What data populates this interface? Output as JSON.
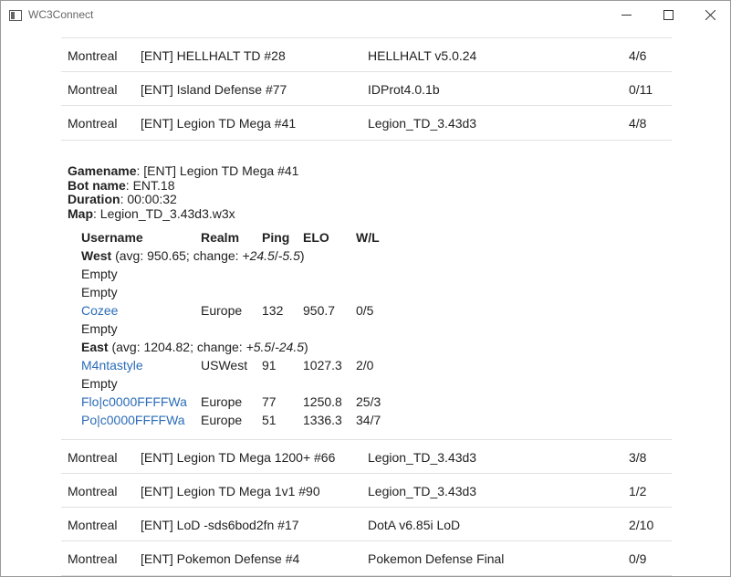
{
  "window": {
    "title": "WC3Connect",
    "icons": {
      "app": "window-app-icon",
      "minimize": "minimize-icon",
      "maximize": "maximize-icon",
      "close": "close-icon"
    }
  },
  "games_top": [
    {
      "location": "Montreal",
      "name": "[ENT] HELLHALT TD #28",
      "map": "HELLHALT v5.0.24",
      "slots": "4/6"
    },
    {
      "location": "Montreal",
      "name": "[ENT] Island Defense #77",
      "map": "IDProt4.0.1b",
      "slots": "0/11"
    },
    {
      "location": "Montreal",
      "name": "[ENT] Legion TD Mega #41",
      "map": "Legion_TD_3.43d3",
      "slots": "4/8"
    }
  ],
  "details": {
    "gamename_label": "Gamename",
    "gamename": "[ENT] Legion TD Mega #41",
    "botname_label": "Bot name",
    "botname": "ENT.18",
    "duration_label": "Duration",
    "duration": "00:00:32",
    "map_label": "Map",
    "map": "Legion_TD_3.43d3.w3x"
  },
  "players": {
    "headers": {
      "username": "Username",
      "realm": "Realm",
      "ping": "Ping",
      "elo": "ELO",
      "wl": "W/L"
    },
    "west": {
      "label": "West",
      "pre": " (avg: 950.65; change: ",
      "plus": "+24.5",
      "sep": "/",
      "minus": "-5.5",
      "post": ")"
    },
    "east": {
      "label": "East",
      "pre": " (avg: 1204.82; change: ",
      "plus": "+5.5",
      "sep": "/",
      "minus": "-24.5",
      "post": ")"
    },
    "west_rows": [
      {
        "username": "Empty",
        "realm": "",
        "ping": "",
        "elo": "",
        "wl": ""
      },
      {
        "username": "Empty",
        "realm": "",
        "ping": "",
        "elo": "",
        "wl": ""
      },
      {
        "username": "Cozee",
        "realm": "Europe",
        "ping": "132",
        "elo": "950.7",
        "wl": "0/5"
      },
      {
        "username": "Empty",
        "realm": "",
        "ping": "",
        "elo": "",
        "wl": ""
      }
    ],
    "east_rows": [
      {
        "username": "M4ntastyle",
        "realm": "USWest",
        "ping": "91",
        "elo": "1027.3",
        "wl": "2/0"
      },
      {
        "username": "Empty",
        "realm": "",
        "ping": "",
        "elo": "",
        "wl": ""
      },
      {
        "username": "Flo|c0000FFFFWa",
        "realm": "Europe",
        "ping": "77",
        "elo": "1250.8",
        "wl": "25/3"
      },
      {
        "username": "Po|c0000FFFFWa",
        "realm": "Europe",
        "ping": "51",
        "elo": "1336.3",
        "wl": "34/7"
      }
    ]
  },
  "games_bottom": [
    {
      "location": "Montreal",
      "name": "[ENT] Legion TD Mega 1200+ #66",
      "map": "Legion_TD_3.43d3",
      "slots": "3/8"
    },
    {
      "location": "Montreal",
      "name": "[ENT] Legion TD Mega 1v1 #90",
      "map": "Legion_TD_3.43d3",
      "slots": "1/2"
    },
    {
      "location": "Montreal",
      "name": "[ENT] LoD -sds6bod2fn #17",
      "map": "DotA v6.85i LoD",
      "slots": "2/10"
    },
    {
      "location": "Montreal",
      "name": "[ENT] Pokemon Defense #4",
      "map": "Pokemon Defense Final",
      "slots": "0/9"
    }
  ]
}
